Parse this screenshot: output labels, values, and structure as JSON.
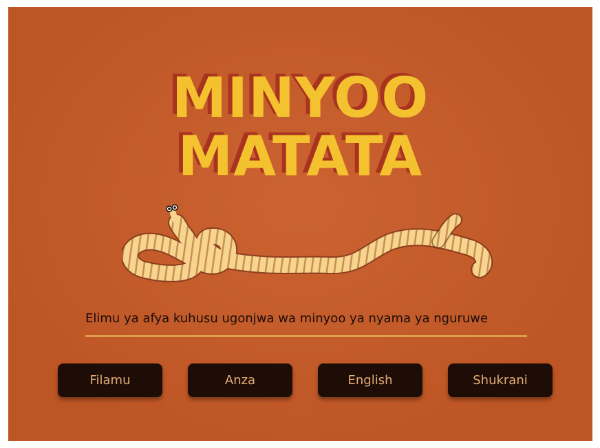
{
  "title": {
    "line1": "MINYOO",
    "line2": "MATATA"
  },
  "subtitle": "Elimu ya afya kuhusu ugonjwa wa minyoo ya nyama ya nguruwe",
  "buttons": [
    {
      "label": "Filamu"
    },
    {
      "label": "Anza"
    },
    {
      "label": "English"
    },
    {
      "label": "Shukrani"
    }
  ],
  "colors": {
    "background": "#c95a26",
    "title": "#f4c12f",
    "title_shadow": "#a8331f",
    "worm_body": "#f7d58f",
    "worm_stripe": "#c98f55",
    "button_bg": "#1e0d07",
    "button_text": "#e4ad73",
    "divider": "#e7b35a"
  },
  "illustration": {
    "name": "tapeworm-illustration"
  }
}
